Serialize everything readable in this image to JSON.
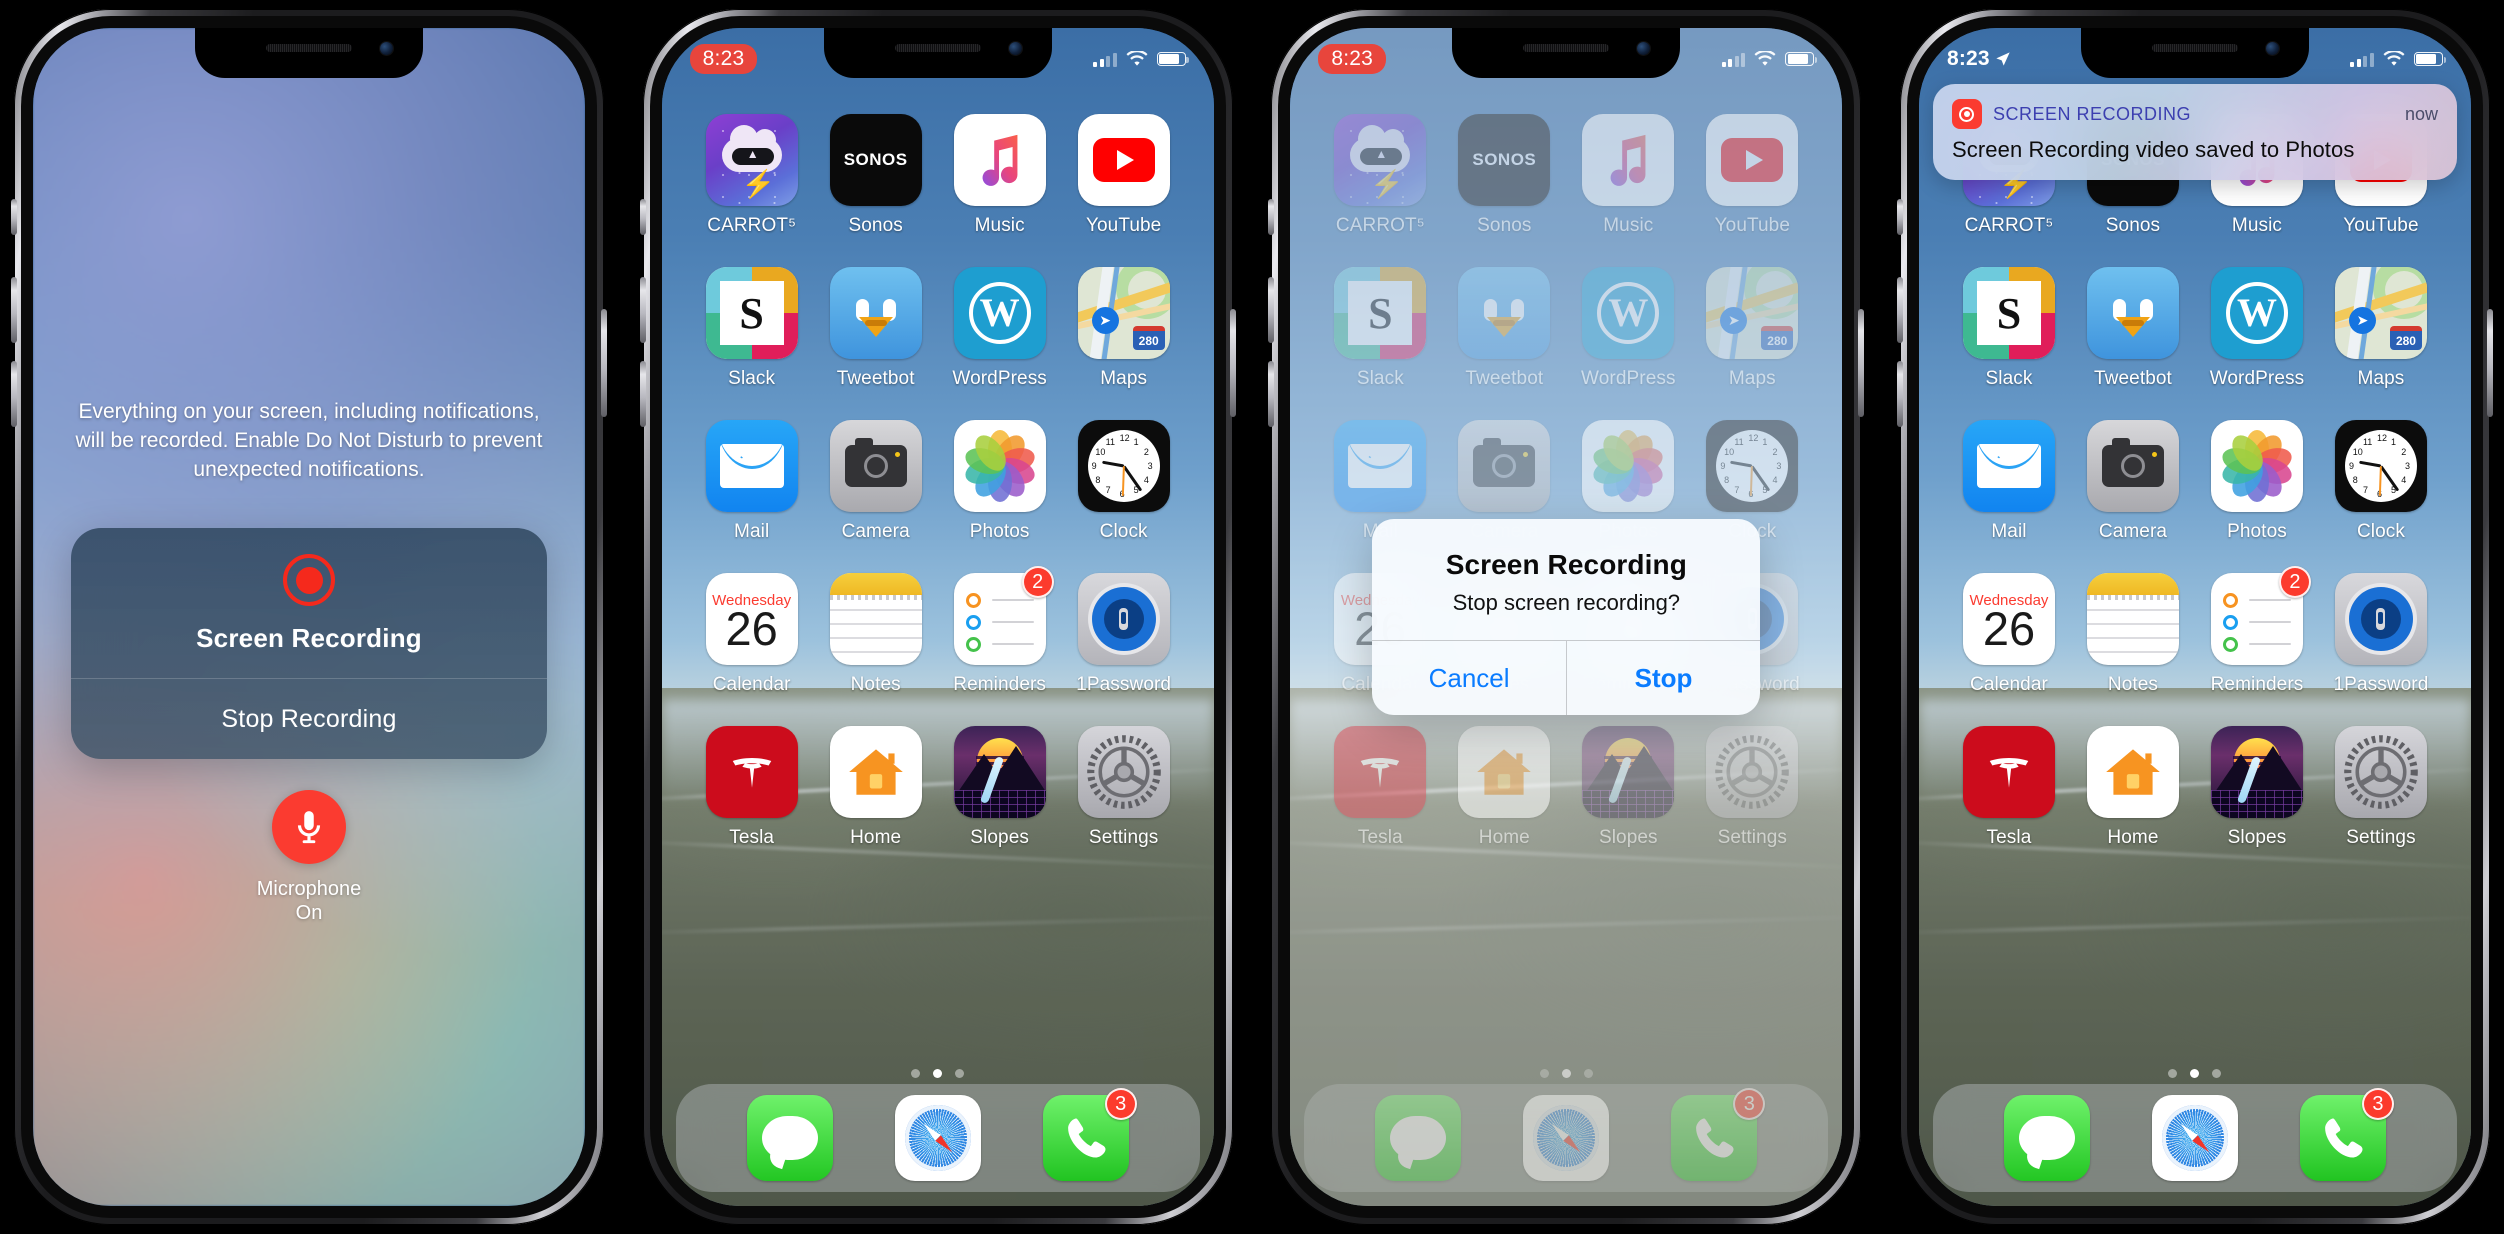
{
  "phones": [
    {
      "id": "phone-1-control-center",
      "status": {
        "time": "",
        "style": "hidden"
      },
      "control_center": {
        "note": "Everything on your screen, including notifications, will be recorded. Enable Do Not Disturb to prevent unexpected notifications.",
        "record_icon": "record-circle-icon",
        "title": "Screen Recording",
        "stop_label": "Stop Recording",
        "mic_icon": "microphone-icon",
        "mic_label_line1": "Microphone",
        "mic_label_line2": "On"
      }
    },
    {
      "id": "phone-2-home",
      "status": {
        "time": "8:23",
        "style": "recording-pill"
      },
      "dimmed": false
    },
    {
      "id": "phone-3-alert",
      "status": {
        "time": "8:23",
        "style": "recording-pill"
      },
      "dimmed": true,
      "alert": {
        "title": "Screen Recording",
        "message": "Stop screen recording?",
        "cancel_label": "Cancel",
        "stop_label": "Stop"
      }
    },
    {
      "id": "phone-4-banner",
      "status": {
        "time": "8:23",
        "style": "plain-with-location"
      },
      "dimmed": false,
      "banner": {
        "icon": "screen-recording-icon",
        "app": "SCREEN RECORDING",
        "time": "now",
        "text": "Screen Recording video saved to Photos"
      }
    }
  ],
  "home_screen": {
    "apps": [
      {
        "label": "CARROT⁵",
        "icon": "carrot-weather-icon",
        "badge": null
      },
      {
        "label": "Sonos",
        "icon": "sonos-icon",
        "badge": null,
        "wordmark": "SONOS"
      },
      {
        "label": "Music",
        "icon": "apple-music-icon",
        "badge": null
      },
      {
        "label": "YouTube",
        "icon": "youtube-icon",
        "badge": null
      },
      {
        "label": "Slack",
        "icon": "slack-icon",
        "badge": null,
        "wordmark": "S"
      },
      {
        "label": "Tweetbot",
        "icon": "tweetbot-icon",
        "badge": null
      },
      {
        "label": "WordPress",
        "icon": "wordpress-icon",
        "badge": null,
        "wordmark": "W"
      },
      {
        "label": "Maps",
        "icon": "apple-maps-icon",
        "badge": null,
        "wordmark": "280"
      },
      {
        "label": "Mail",
        "icon": "mail-icon",
        "badge": null
      },
      {
        "label": "Camera",
        "icon": "camera-icon",
        "badge": null
      },
      {
        "label": "Photos",
        "icon": "photos-icon",
        "badge": null
      },
      {
        "label": "Clock",
        "icon": "clock-icon",
        "badge": null
      },
      {
        "label": "Calendar",
        "icon": "calendar-icon",
        "badge": null,
        "weekday": "Wednesday",
        "day": "26"
      },
      {
        "label": "Notes",
        "icon": "notes-icon",
        "badge": null
      },
      {
        "label": "Reminders",
        "icon": "reminders-icon",
        "badge": "2"
      },
      {
        "label": "1Password",
        "icon": "onepassword-icon",
        "badge": null
      },
      {
        "label": "Tesla",
        "icon": "tesla-icon",
        "badge": null
      },
      {
        "label": "Home",
        "icon": "home-icon",
        "badge": null
      },
      {
        "label": "Slopes",
        "icon": "slopes-icon",
        "badge": null
      },
      {
        "label": "Settings",
        "icon": "settings-gear-icon",
        "badge": null
      }
    ],
    "page_dots": {
      "count": 3,
      "active_index": 1
    },
    "dock": [
      {
        "label": "Messages",
        "icon": "messages-icon",
        "badge": null
      },
      {
        "label": "Safari",
        "icon": "safari-compass-icon",
        "badge": null
      },
      {
        "label": "Phone",
        "icon": "phone-icon",
        "badge": "3"
      }
    ]
  },
  "colors": {
    "record_red": "#f5291c",
    "badge_red": "#fb3b30",
    "alert_blue": "#0a7cff",
    "banner_app_blue": "#3c3fb0",
    "status_pill_red": "#e8453c"
  }
}
